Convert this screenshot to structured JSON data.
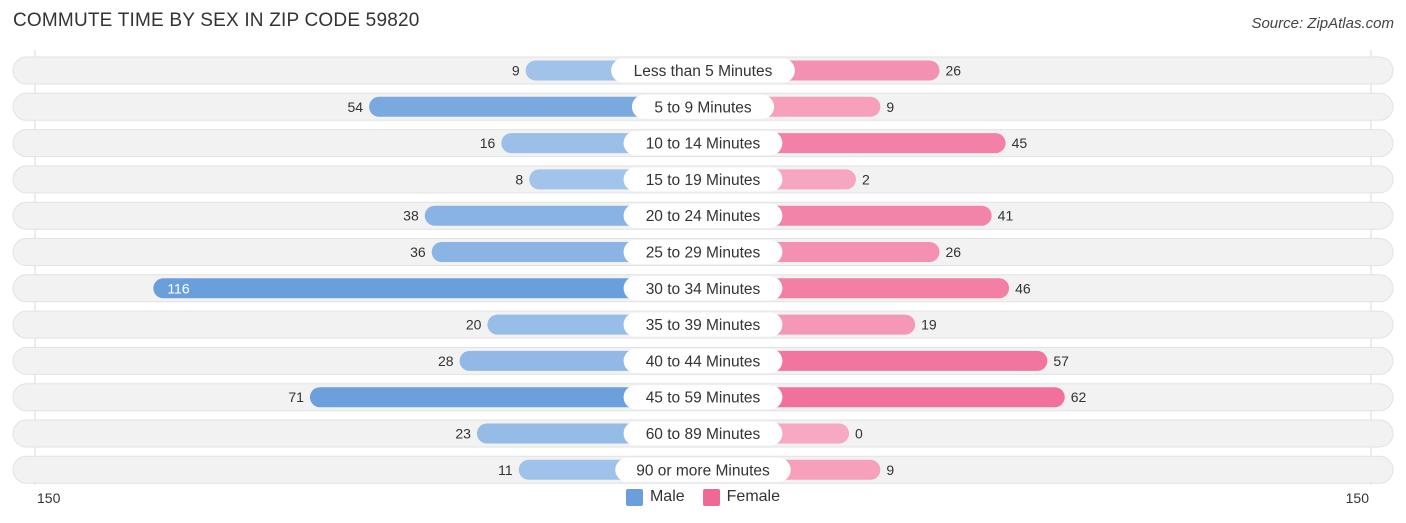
{
  "header": {
    "title": "COMMUTE TIME BY SEX IN ZIP CODE 59820",
    "source": "Source: ZipAtlas.com"
  },
  "colors": {
    "male": "#6a9fdc",
    "male_light": "#a9c8ec",
    "female": "#f06895",
    "female_light": "#f7a8c2",
    "track": "#f2f2f2"
  },
  "chart_data": {
    "type": "bar",
    "orientation": "horizontal-diverging",
    "title": "COMMUTE TIME BY SEX IN ZIP CODE 59820",
    "categories": [
      "Less than 5 Minutes",
      "5 to 9 Minutes",
      "10 to 14 Minutes",
      "15 to 19 Minutes",
      "20 to 24 Minutes",
      "25 to 29 Minutes",
      "30 to 34 Minutes",
      "35 to 39 Minutes",
      "40 to 44 Minutes",
      "45 to 59 Minutes",
      "60 to 89 Minutes",
      "90 or more Minutes"
    ],
    "series": [
      {
        "name": "Male",
        "values": [
          9,
          54,
          16,
          8,
          38,
          36,
          116,
          20,
          28,
          71,
          23,
          11
        ]
      },
      {
        "name": "Female",
        "values": [
          26,
          9,
          45,
          2,
          41,
          26,
          46,
          19,
          57,
          62,
          0,
          9
        ]
      }
    ],
    "axis": {
      "left_label": "150",
      "right_label": "150",
      "range": [
        150,
        150
      ]
    },
    "legend": {
      "position": "bottom-center",
      "entries": [
        "Male",
        "Female"
      ]
    },
    "grid": false
  }
}
